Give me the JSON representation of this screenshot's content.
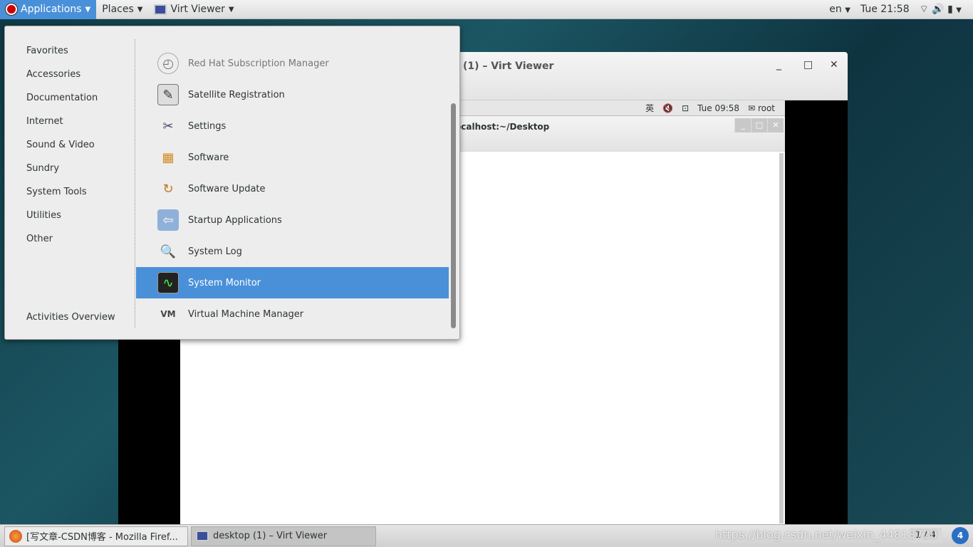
{
  "topbar": {
    "applications": "Applications",
    "places": "Places",
    "virt_viewer": "Virt Viewer",
    "lang": "en",
    "clock": "Tue 21:58"
  },
  "menu": {
    "categories": [
      "Favorites",
      "Accessories",
      "Documentation",
      "Internet",
      "Sound & Video",
      "Sundry",
      "System Tools",
      "Utilities",
      "Other"
    ],
    "activities": "Activities Overview",
    "apps": [
      "Red Hat Subscription Manager",
      "Satellite Registration",
      "Settings",
      "Software",
      "Software Update",
      "Startup Applications",
      "System Log",
      "System Monitor",
      "Virtual Machine Manager"
    ],
    "selected": "System Monitor"
  },
  "viewer": {
    "title": "(1) – Virt Viewer",
    "guest_lang": "英",
    "guest_clock": "Tue 09:58",
    "guest_user": "root",
    "guest_window_title": "ocalhost:~/Desktop"
  },
  "taskbar": {
    "firefox": "[写文章-CSDN博客 - Mozilla Firef...",
    "viewer": "desktop (1) – Virt Viewer",
    "pager": "1 / 4",
    "notif": "4",
    "watermark": "https://blog.csdn.net/weixin_44818720"
  },
  "colors": {
    "accent": "#4a90d9"
  }
}
